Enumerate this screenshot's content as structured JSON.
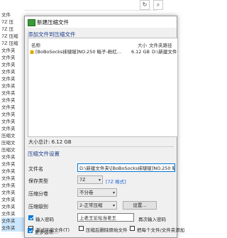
{
  "background": {
    "refresh_icon": "↻",
    "search_icon": "⌕",
    "rows": [
      "文件",
      "7Z 压",
      "7Z 压",
      "7Z 压缩",
      "7Z 压缩",
      "文件夹",
      "文件夹",
      "文件夹",
      "文件夹",
      "文件夹",
      "文件夹",
      "文件夹",
      "文件夹",
      "文件夹",
      "文件夹",
      "文件夹",
      "文件夹",
      "压缩文",
      "压缩文",
      "压缩文",
      "文件夹",
      "文件夹",
      "文件夹",
      "文件夹",
      "文件夹",
      "文件夹",
      "文件夹",
      "文件夹",
      "文件夹",
      "文件夹",
      "文件夹"
    ]
  },
  "dialog": {
    "title": "新建压缩文件",
    "add_section_title": "添加文件到压缩文件",
    "columns": {
      "name": "名称",
      "size": "大小",
      "path": "文件夹路径"
    },
    "file": {
      "name": "[BoBoSocks袜啵啵]NO.250 暗子-粉红...",
      "size": "6.12 GB",
      "path": "D:\\新建文件夹\\[Bo"
    },
    "total_size": "大小总计: 6.12 GB",
    "settings_title": "压缩文件设置",
    "filename_label": "文件名",
    "filename_value": "D:\\新建文件夹\\[BoBoSocks袜啵啵]NO.250 暗子-粉",
    "save_type_label": "保存类型",
    "save_type_value": "7Z",
    "save_type_link": "[7Z 格式]",
    "split_label": "压缩分卷",
    "split_value": "不分卷",
    "level_label": "压缩级别",
    "level_value": "2-正常压缩",
    "settings_button": "设置...",
    "password_checkbox_label": "输入密码",
    "password_value": "上老王论坛当老王",
    "show_password_label": "再次输入密码",
    "test_checkbox_label": "测试压缩文件(T)",
    "delete_checkbox_label": "压缩后删除原始文件",
    "separate_checkbox_label": "把每个文件/文件夹添加",
    "more_options_label": "更多选项..."
  }
}
